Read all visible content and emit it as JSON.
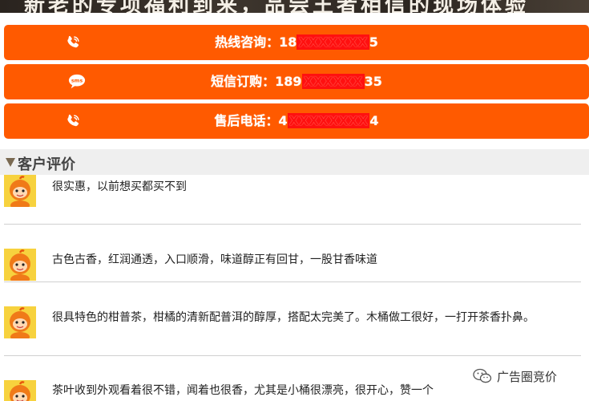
{
  "banner": {
    "text": "新老的专项福利到来，品尝王者相信的现场体验"
  },
  "cta_buttons": [
    {
      "icon": "phone-icon",
      "label": "热线咨询：18",
      "redacted": "XXXXXXX",
      "suffix": "5"
    },
    {
      "icon": "sms-icon",
      "label": "短信订购：189",
      "redacted": "XXXXXX",
      "suffix": "35",
      "icon_text": "sms"
    },
    {
      "icon": "phone-icon",
      "label": "售后电话：4",
      "redacted": "XXXXXXXX",
      "suffix": "4"
    }
  ],
  "reviews_section": {
    "title": "客户评价"
  },
  "reviews": [
    {
      "text": "很实惠，以前想买都买不到"
    },
    {
      "text": "古色古香，红润通透，入口顺滑，味道醇正有回甘，一股甘香味道"
    },
    {
      "text": "很具特色的柑普茶，柑橘的清新配普洱的醇厚，搭配太完美了。木桶做工很好，一打开茶香扑鼻。"
    },
    {
      "text": "茶叶收到外观看着很不错，闻着也很香，尤其是小桶很漂亮，很开心，赞一个"
    }
  ],
  "watermark": {
    "text": "广告圈竞价",
    "icon": "wechat-icon"
  },
  "colors": {
    "accent": "#ff5a00",
    "section_bg": "#efefef"
  }
}
